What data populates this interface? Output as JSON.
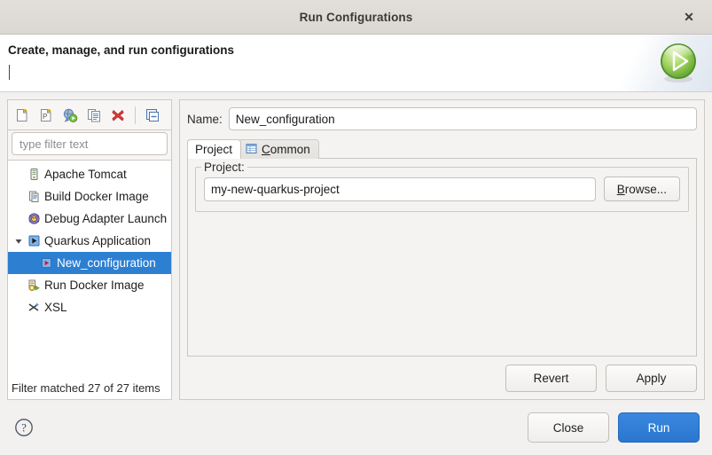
{
  "window": {
    "title": "Run Configurations",
    "close_label": "✕"
  },
  "header": {
    "title": "Create, manage, and run configurations",
    "badge_icon": "green-run-play-icon"
  },
  "toolbar": {
    "buttons": [
      {
        "name": "new-launch-configuration",
        "icon": "new-file-icon",
        "tooltip": "New launch configuration"
      },
      {
        "name": "new-prototype",
        "icon": "new-prototype-icon",
        "tooltip": "New prototype"
      },
      {
        "name": "export",
        "icon": "export-run-icon",
        "tooltip": "Export"
      },
      {
        "name": "duplicate",
        "icon": "duplicate-icon",
        "tooltip": "Duplicate"
      },
      {
        "name": "delete",
        "icon": "delete-red-x-icon",
        "tooltip": "Delete"
      },
      {
        "name": "collapse-all",
        "icon": "collapse-all-icon",
        "tooltip": "Collapse All"
      }
    ]
  },
  "filter": {
    "value": "",
    "placeholder": "type filter text"
  },
  "tree": {
    "items": [
      {
        "label": "Apache Tomcat",
        "icon": "tomcat-icon",
        "indent": 0,
        "selected": false,
        "expander": "none"
      },
      {
        "label": "Build Docker Image",
        "icon": "docker-build-icon",
        "indent": 0,
        "selected": false,
        "expander": "none"
      },
      {
        "label": "Debug Adapter Launch",
        "icon": "debug-adapter-icon",
        "indent": 0,
        "selected": false,
        "expander": "none"
      },
      {
        "label": "Quarkus Application",
        "icon": "quarkus-icon",
        "indent": 0,
        "selected": false,
        "expander": "expanded"
      },
      {
        "label": "New_configuration",
        "icon": "quarkus-config-icon",
        "indent": 1,
        "selected": true,
        "expander": "none"
      },
      {
        "label": "Run Docker Image",
        "icon": "docker-run-icon",
        "indent": 0,
        "selected": false,
        "expander": "none"
      },
      {
        "label": "XSL",
        "icon": "xsl-icon",
        "indent": 0,
        "selected": false,
        "expander": "none"
      }
    ],
    "status": "Filter matched 27 of 27 items"
  },
  "config": {
    "name_label": "Name:",
    "name_value": "New_configuration",
    "tabs": [
      {
        "label": "Project",
        "icon": null,
        "active": true
      },
      {
        "label": "Common",
        "icon": "common-table-icon",
        "active": false,
        "mnemonic": "C"
      }
    ],
    "project_group_title": "Project:",
    "project_value": "my-new-quarkus-project",
    "browse_label": "Browse...",
    "browse_mnemonic": "B",
    "revert_label": "Revert",
    "apply_label": "Apply"
  },
  "footer": {
    "help_icon": "help-question-icon",
    "close_label": "Close",
    "run_label": "Run"
  },
  "colors": {
    "selection_blue": "#2d7fd2",
    "primary_button_blue": "#3584e4",
    "run_badge_green": "#78c043",
    "delete_red": "#d93d3d",
    "dialog_background": "#f2f1f0",
    "header_background": "#ffffff"
  }
}
